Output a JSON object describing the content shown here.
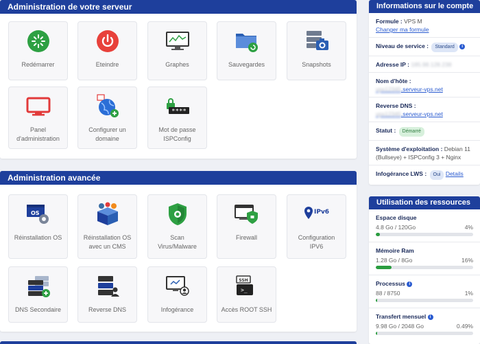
{
  "panel1": {
    "title": "Administration de votre serveur",
    "tiles": [
      {
        "label": "Redémarrer",
        "icon": "restart-icon"
      },
      {
        "label": "Eteindre",
        "icon": "power-icon"
      },
      {
        "label": "Graphes",
        "icon": "graph-monitor-icon"
      },
      {
        "label": "Sauvegardes",
        "icon": "backup-folder-icon"
      },
      {
        "label": "Snapshots",
        "icon": "snapshot-server-icon"
      },
      {
        "label": "Panel\nd'administration",
        "icon": "admin-panel-icon"
      },
      {
        "label": "Configurer un\ndomaine",
        "icon": "domain-globe-icon"
      },
      {
        "label": "Mot de passe\nISPConfig",
        "icon": "password-lock-icon"
      }
    ]
  },
  "panel2": {
    "title": "Administration avancée",
    "tiles": [
      {
        "label": "Réinstallation OS",
        "icon": "os-reinstall-icon"
      },
      {
        "label": "Réinstallation OS\navec un CMS",
        "icon": "cms-box-icon"
      },
      {
        "label": "Scan\nVirus/Malware",
        "icon": "virus-shield-icon"
      },
      {
        "label": "Firewall",
        "icon": "firewall-icon"
      },
      {
        "label": "Configuration\nIPV6",
        "icon": "ipv6-pin-icon",
        "badge": "IPv6"
      },
      {
        "label": "DNS Secondaire",
        "icon": "dns-secondary-icon",
        "badge": "DNS"
      },
      {
        "label": "Reverse DNS",
        "icon": "reverse-dns-icon",
        "badge": "DNS"
      },
      {
        "label": "Infogérance",
        "icon": "support-agent-icon"
      },
      {
        "label": "Accès ROOT SSH",
        "icon": "ssh-terminal-icon",
        "badge": "SSH"
      }
    ]
  },
  "info": {
    "title": "Informations sur le compte",
    "formule_label": "Formule :",
    "formule_value": "VPS M",
    "formule_link": "Changer ma formule",
    "niveau_label": "Niveau de service :",
    "niveau_value": "Standard",
    "ip_label": "Adresse IP :",
    "ip_value": "185.98.128.238",
    "hostname_label": "Nom d'hôte :",
    "hostname_blur": "vps12345",
    "hostname_value": ".serveur-vps.net",
    "reverse_label": "Reverse DNS :",
    "reverse_blur": "vps12345",
    "reverse_value": ".serveur-vps.net",
    "statut_label": "Statut :",
    "statut_value": "Démarré",
    "os_label": "Système d'exploitation :",
    "os_value": " Debian 11 (Bullseye) + ISPConfig 3 + Nginx",
    "infog_label": "Infogérance LWS :",
    "infog_value": "Oui",
    "infog_link": "Details"
  },
  "resources": {
    "title": "Utilisation des ressources",
    "items": [
      {
        "name": "Espace disque",
        "usage": "4.8 Go / 120Go",
        "percent_label": "4%",
        "percent": 4,
        "info": false
      },
      {
        "name": "Mémoire Ram",
        "usage": "1.28 Go / 8Go",
        "percent_label": "16%",
        "percent": 16,
        "info": false
      },
      {
        "name": "Processus",
        "usage": "88 / 8750",
        "percent_label": "1%",
        "percent": 1,
        "info": true
      },
      {
        "name": "Transfert mensuel",
        "usage": "9.98 Go / 2048 Go",
        "percent_label": "0.49%",
        "percent": 0.49,
        "info": true
      }
    ]
  },
  "colors": {
    "header": "#1e3f9c",
    "bar": "#2a9d3f",
    "link": "#2a5bd0"
  }
}
